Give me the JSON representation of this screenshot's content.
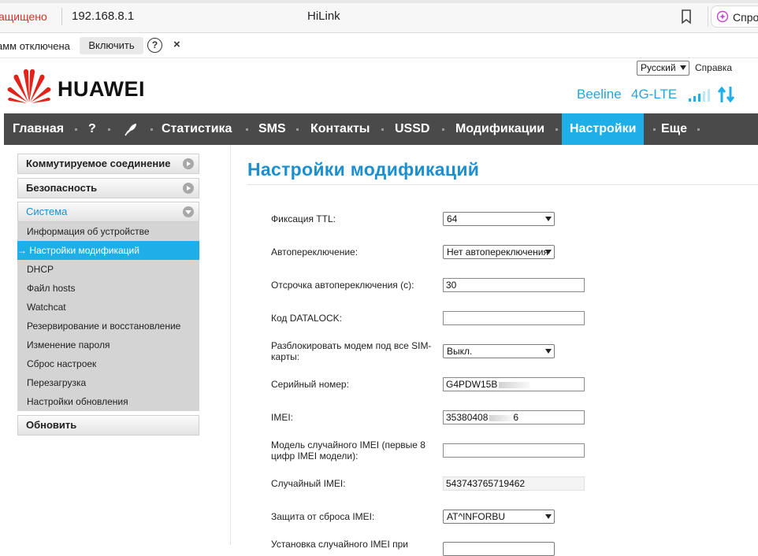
{
  "browser": {
    "security_text": "ащищено",
    "url": "192.168.8.1",
    "tab_title": "HiLink",
    "ask_label": "Спро"
  },
  "infobar": {
    "message": "амм отключена",
    "enable_label": "Включить",
    "help_label": "?",
    "close_label": "×"
  },
  "header": {
    "language": "Русский",
    "help_link": "Справка",
    "logo_text": "HUAWEI",
    "operator": "Beeline",
    "network_type": "4G-LTE",
    "brand_color": "#e2231a",
    "accent_color": "#1eaee8"
  },
  "nav": {
    "items": [
      {
        "label": "Главная"
      },
      {
        "label": "?"
      },
      {
        "label": "Статистика"
      },
      {
        "label": "SMS"
      },
      {
        "label": "Контакты"
      },
      {
        "label": "USSD"
      },
      {
        "label": "Модификации"
      },
      {
        "label": "Настройки",
        "active": true
      },
      {
        "label": "Еще"
      }
    ],
    "icon": "quill-icon"
  },
  "sidebar": {
    "sections": [
      {
        "label": "Коммутируемое соединение"
      },
      {
        "label": "Безопасность"
      },
      {
        "label": "Система"
      }
    ],
    "items": [
      {
        "label": "Информация об устройстве"
      },
      {
        "label": "→ Настройки модификаций",
        "active": true
      },
      {
        "label": "DHCP"
      },
      {
        "label": "Файл hosts"
      },
      {
        "label": "Watchcat"
      },
      {
        "label": "Резервирование и восстановление"
      },
      {
        "label": "Изменение пароля"
      },
      {
        "label": "Сброс настроек"
      },
      {
        "label": "Перезагрузка"
      },
      {
        "label": "Настройки обновления"
      }
    ],
    "update_label": "Обновить"
  },
  "main": {
    "title": "Настройки модификаций",
    "fields": [
      {
        "label": "Фиксация TTL:",
        "type": "select",
        "value": "64"
      },
      {
        "label": "Автопереключение:",
        "type": "select",
        "value": "Нет автопереключения"
      },
      {
        "label": "Отсрочка автопереключения (с):",
        "type": "input",
        "value": "30"
      },
      {
        "label": "Код DATALOCK:",
        "type": "input",
        "value": ""
      },
      {
        "label_line1": "Разблокировать модем под все SIM-",
        "label_line2": "карты:",
        "type": "select",
        "value": "Выкл."
      },
      {
        "label": "Серийный номер:",
        "type": "input",
        "value": "G4PDW15B"
      },
      {
        "label": "IMEI:",
        "type": "input",
        "value_start": "35380408",
        "value_end": "6"
      },
      {
        "label_line1": "Модель случайного IMEI (первые 8",
        "label_line2": "цифр IMEI модели):",
        "type": "input",
        "value": ""
      },
      {
        "label": "Случайный IMEI:",
        "type": "readonly",
        "value": "543743765719462"
      },
      {
        "label": "Защита от сброса IMEI:",
        "type": "select",
        "value": "AT^INFORBU"
      },
      {
        "label": "Установка случайного IMEI при",
        "type": "select",
        "value": ""
      }
    ]
  }
}
